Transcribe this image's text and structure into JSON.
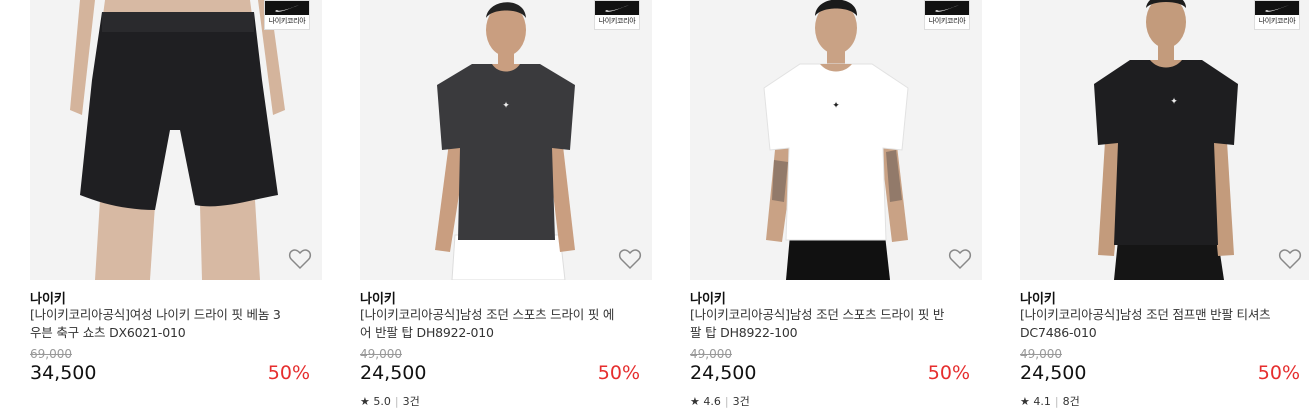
{
  "badge": {
    "text": "나이키코리아"
  },
  "products": [
    {
      "brand": "나이키",
      "title": "[나이키코리아공식]여성 나이키 드라이 핏 베놈 3 우븐 축구 쇼츠 DX6021-010",
      "original_price": "69,000",
      "price": "34,500",
      "discount": "50%",
      "rating": "",
      "reviews": "",
      "image": "black-shorts"
    },
    {
      "brand": "나이키",
      "title": "[나이키코리아공식]남성 조던 스포츠 드라이 핏 에어 반팔 탑 DH8922-010",
      "original_price": "49,000",
      "price": "24,500",
      "discount": "50%",
      "rating": "5.0",
      "reviews": "3건",
      "image": "dark-tshirt"
    },
    {
      "brand": "나이키",
      "title": "[나이키코리아공식]남성 조던 스포츠 드라이 핏 반팔 탑 DH8922-100",
      "original_price": "49,000",
      "price": "24,500",
      "discount": "50%",
      "rating": "4.6",
      "reviews": "3건",
      "image": "white-tshirt"
    },
    {
      "brand": "나이키",
      "title": "[나이키코리아공식]남성 조던 점프맨 반팔 티셔츠 DC7486-010",
      "original_price": "49,000",
      "price": "24,500",
      "discount": "50%",
      "rating": "4.1",
      "reviews": "8건",
      "image": "black-tshirt"
    }
  ]
}
